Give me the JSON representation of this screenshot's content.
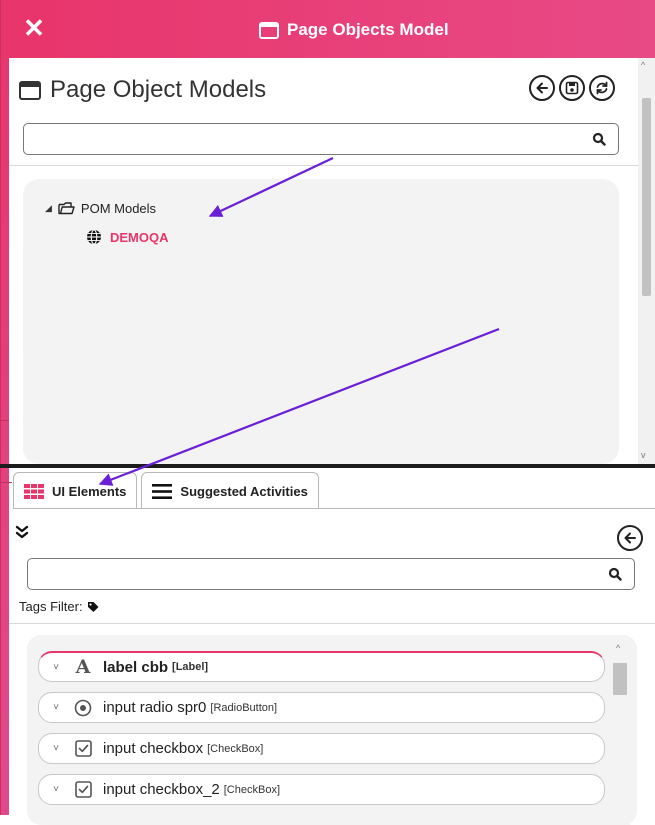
{
  "window": {
    "title": "Page Objects Model",
    "close_icon": "close-x-icon"
  },
  "top_panel": {
    "heading": "Page Object Models",
    "actions": [
      "back-arrow-icon",
      "save-icon",
      "refresh-icon"
    ],
    "search": {
      "value": "",
      "placeholder": ""
    },
    "tree": {
      "root": {
        "label": "POM Models",
        "expanded": true,
        "icon": "folder-open-icon"
      },
      "children": [
        {
          "label": "DEMOQA",
          "icon": "globe-icon",
          "color": "#e8356b"
        }
      ]
    }
  },
  "tabs": [
    {
      "label": "UI Elements",
      "icon": "grid-icon",
      "active": true
    },
    {
      "label": "Suggested Activities",
      "icon": "list-icon",
      "active": false
    }
  ],
  "lower_panel": {
    "search": {
      "value": "",
      "placeholder": ""
    },
    "tags_filter_label": "Tags Filter:",
    "elements": [
      {
        "name": "label cbb",
        "type": "[Label]",
        "icon": "text-label-icon"
      },
      {
        "name": "input radio spr0",
        "type": "[RadioButton]",
        "icon": "radio-button-icon"
      },
      {
        "name": "input checkbox",
        "type": "[CheckBox]",
        "icon": "checkbox-icon"
      },
      {
        "name": "input checkbox_2",
        "type": "[CheckBox]",
        "icon": "checkbox-icon"
      }
    ]
  },
  "colors": {
    "accent": "#e8356b",
    "accent_light": "#e84a86",
    "divider": "#1c1c1c",
    "annotation_arrow": "#6a1ed8"
  }
}
